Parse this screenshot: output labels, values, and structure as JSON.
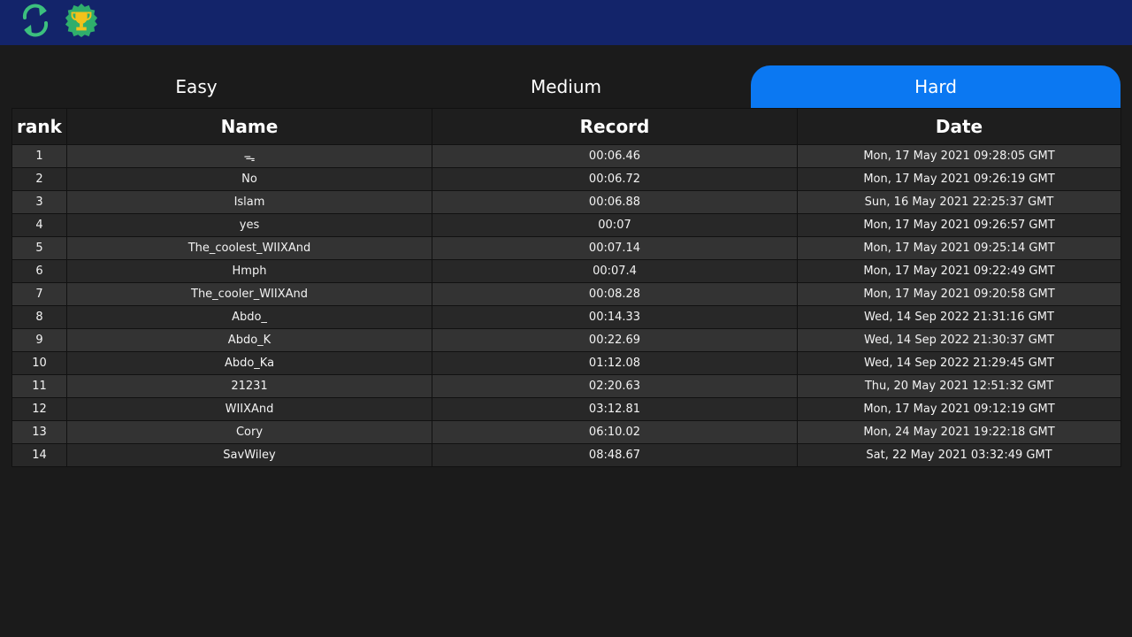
{
  "header": {
    "refresh_icon": "refresh-icon",
    "trophy_icon": "trophy-icon",
    "colors": {
      "bar": "#13246a",
      "refresh": "#3cc07e",
      "badge": "#2fae6c",
      "trophy": "#f2c21b"
    }
  },
  "tabs": [
    {
      "label": "Easy",
      "active": false
    },
    {
      "label": "Medium",
      "active": false
    },
    {
      "label": "Hard",
      "active": true
    }
  ],
  "accent_color": "#0b78f2",
  "table": {
    "headers": {
      "rank": "rank",
      "name": "Name",
      "record": "Record",
      "date": "Date"
    },
    "rows": [
      {
        "rank": "1",
        "name": "ᯓ",
        "record": "00:06.46",
        "date": "Mon, 17 May 2021 09:28:05 GMT"
      },
      {
        "rank": "2",
        "name": "No",
        "record": "00:06.72",
        "date": "Mon, 17 May 2021 09:26:19 GMT"
      },
      {
        "rank": "3",
        "name": "Islam",
        "record": "00:06.88",
        "date": "Sun, 16 May 2021 22:25:37 GMT"
      },
      {
        "rank": "4",
        "name": "yes",
        "record": "00:07",
        "date": "Mon, 17 May 2021 09:26:57 GMT"
      },
      {
        "rank": "5",
        "name": "The_coolest_WIIXAnd",
        "record": "00:07.14",
        "date": "Mon, 17 May 2021 09:25:14 GMT"
      },
      {
        "rank": "6",
        "name": "Hmph",
        "record": "00:07.4",
        "date": "Mon, 17 May 2021 09:22:49 GMT"
      },
      {
        "rank": "7",
        "name": "The_cooler_WIIXAnd",
        "record": "00:08.28",
        "date": "Mon, 17 May 2021 09:20:58 GMT"
      },
      {
        "rank": "8",
        "name": "Abdo_",
        "record": "00:14.33",
        "date": "Wed, 14 Sep 2022 21:31:16 GMT"
      },
      {
        "rank": "9",
        "name": "Abdo_K",
        "record": "00:22.69",
        "date": "Wed, 14 Sep 2022 21:30:37 GMT"
      },
      {
        "rank": "10",
        "name": "Abdo_Ka",
        "record": "01:12.08",
        "date": "Wed, 14 Sep 2022 21:29:45 GMT"
      },
      {
        "rank": "11",
        "name": "21231",
        "record": "02:20.63",
        "date": "Thu, 20 May 2021 12:51:32 GMT"
      },
      {
        "rank": "12",
        "name": "WIIXAnd",
        "record": "03:12.81",
        "date": "Mon, 17 May 2021 09:12:19 GMT"
      },
      {
        "rank": "13",
        "name": "Cory",
        "record": "06:10.02",
        "date": "Mon, 24 May 2021 19:22:18 GMT"
      },
      {
        "rank": "14",
        "name": "SavWiley",
        "record": "08:48.67",
        "date": "Sat, 22 May 2021 03:32:49 GMT"
      }
    ]
  }
}
